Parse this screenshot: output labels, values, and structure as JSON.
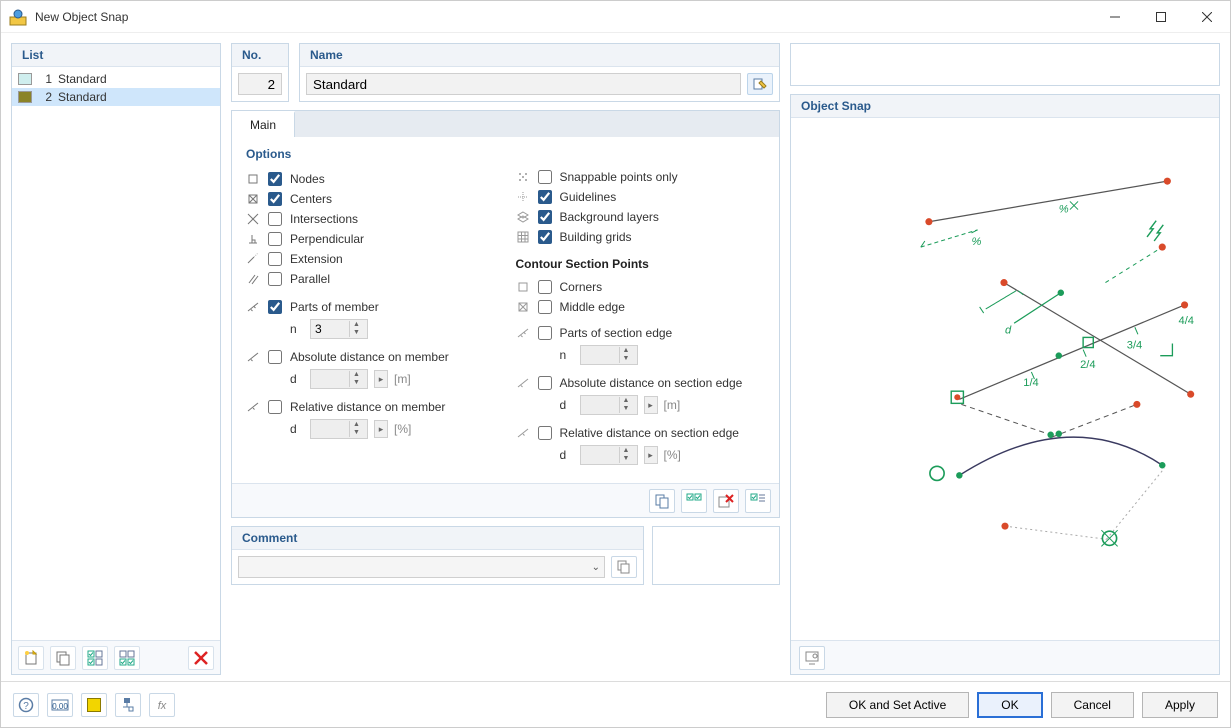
{
  "window": {
    "title": "New Object Snap"
  },
  "list": {
    "header": "List",
    "items": [
      {
        "index": "1",
        "name": "Standard",
        "color": "#cfeeee",
        "selected": false
      },
      {
        "index": "2",
        "name": "Standard",
        "color": "#8a8328",
        "selected": true
      }
    ]
  },
  "no_panel": {
    "header": "No.",
    "value": "2"
  },
  "name_panel": {
    "header": "Name",
    "value": "Standard"
  },
  "tabs": {
    "main": "Main"
  },
  "options": {
    "header": "Options",
    "left": {
      "nodes": {
        "label": "Nodes",
        "checked": true
      },
      "centers": {
        "label": "Centers",
        "checked": true
      },
      "intersections": {
        "label": "Intersections",
        "checked": false
      },
      "perpendicular": {
        "label": "Perpendicular",
        "checked": false
      },
      "extension": {
        "label": "Extension",
        "checked": false
      },
      "parallel": {
        "label": "Parallel",
        "checked": false
      },
      "parts_member": {
        "label": "Parts of member",
        "checked": true,
        "n_label": "n",
        "n_value": "3"
      },
      "abs_member": {
        "label": "Absolute distance on member",
        "checked": false,
        "d_label": "d",
        "unit": "[m]"
      },
      "rel_member": {
        "label": "Relative distance on member",
        "checked": false,
        "d_label": "d",
        "unit": "[%]"
      }
    },
    "right": {
      "snappable": {
        "label": "Snappable points only",
        "checked": false
      },
      "guidelines": {
        "label": "Guidelines",
        "checked": true
      },
      "bg_layers": {
        "label": "Background layers",
        "checked": true
      },
      "building_grids": {
        "label": "Building grids",
        "checked": true
      },
      "contour_header": "Contour Section Points",
      "corners": {
        "label": "Corners",
        "checked": false
      },
      "middle_edge": {
        "label": "Middle edge",
        "checked": false
      },
      "parts_edge": {
        "label": "Parts of section edge",
        "checked": false,
        "n_label": "n"
      },
      "abs_edge": {
        "label": "Absolute distance on section edge",
        "checked": false,
        "d_label": "d",
        "unit": "[m]"
      },
      "rel_edge": {
        "label": "Relative distance on section edge",
        "checked": false,
        "d_label": "d",
        "unit": "[%]"
      }
    }
  },
  "comment": {
    "header": "Comment"
  },
  "preview": {
    "header": "Object Snap",
    "labels": {
      "f14": "1/4",
      "f24": "2/4",
      "f34": "3/4",
      "f44": "4/4",
      "pct": "%",
      "pctx": "%",
      "d": "d"
    }
  },
  "buttons": {
    "ok_active": "OK and Set Active",
    "ok": "OK",
    "cancel": "Cancel",
    "apply": "Apply"
  }
}
